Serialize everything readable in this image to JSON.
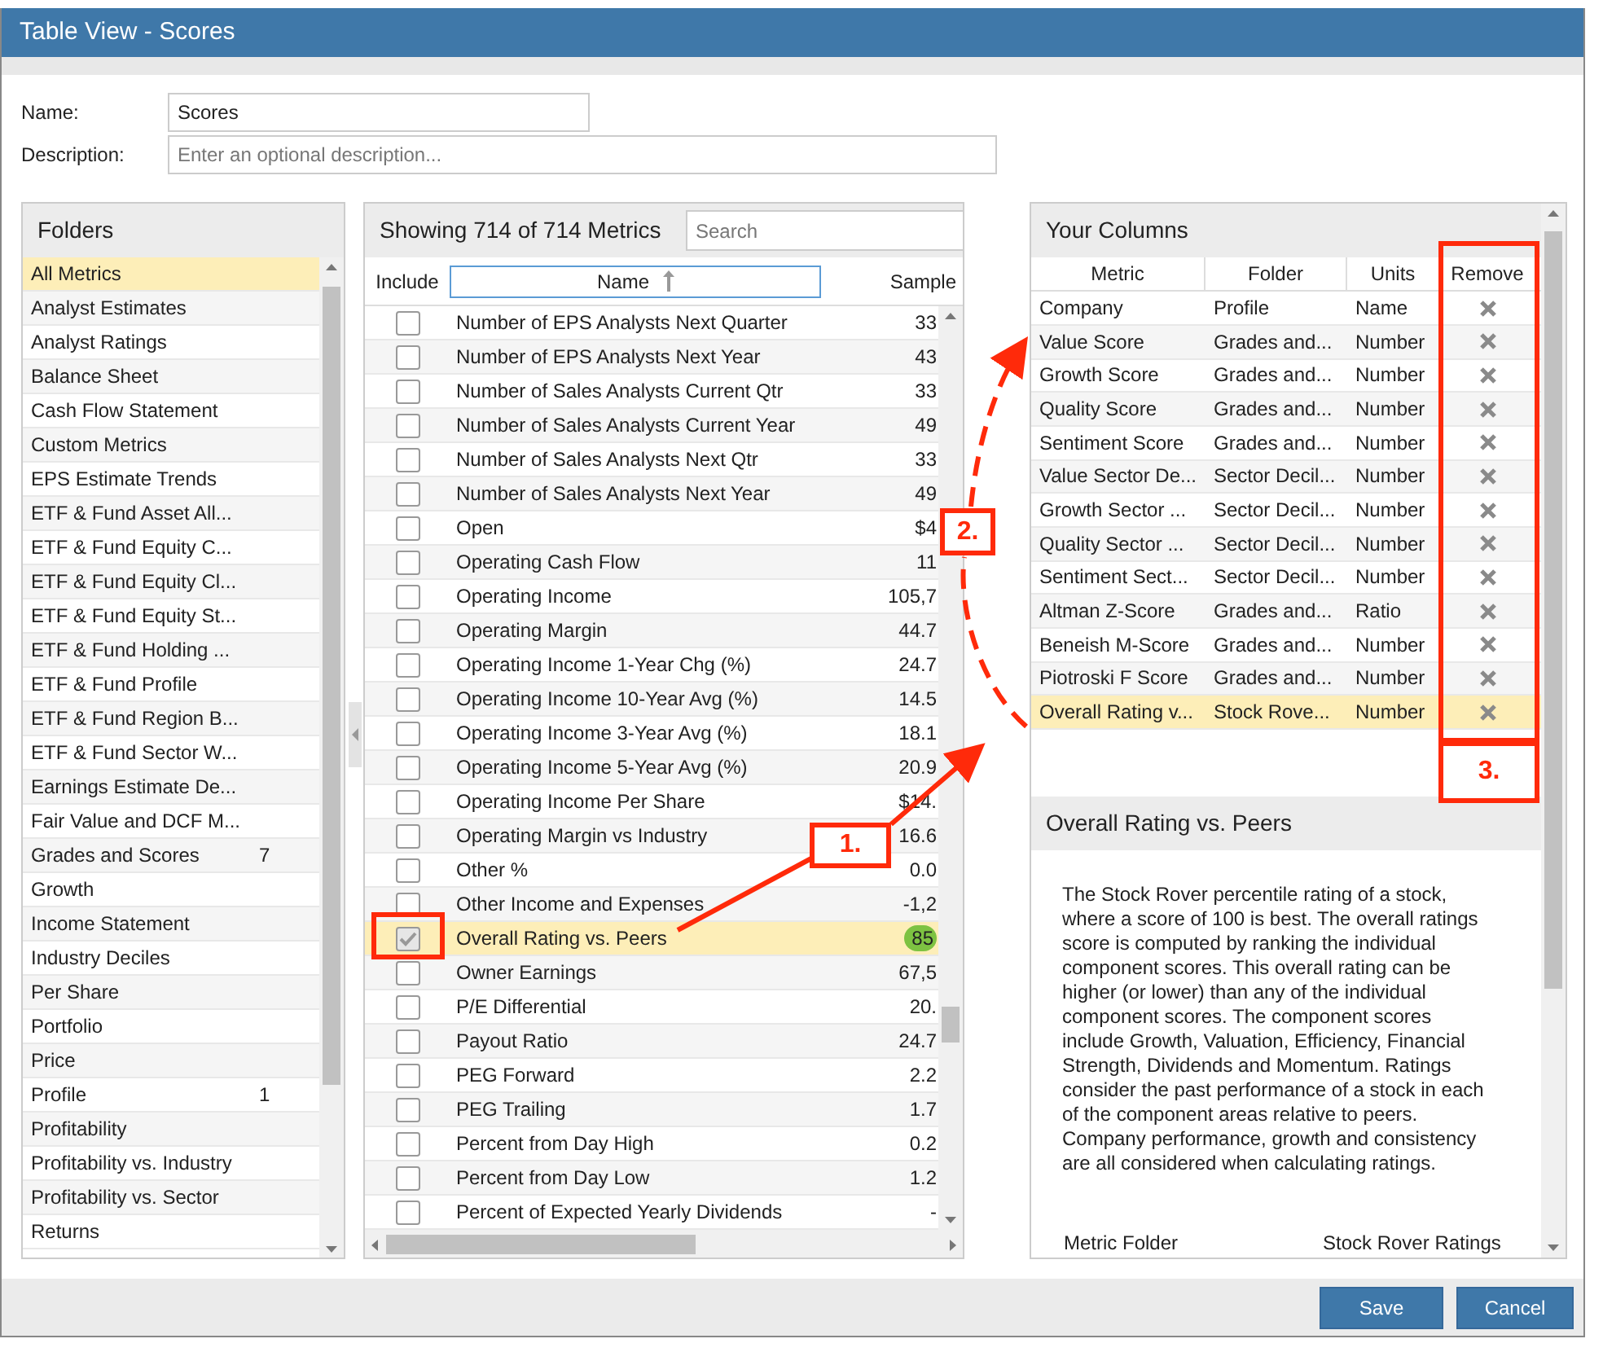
{
  "window": {
    "title": "Table View - Scores"
  },
  "form": {
    "name_label": "Name:",
    "name_value": "Scores",
    "description_label": "Description:",
    "description_placeholder": "Enter an optional description..."
  },
  "folders": {
    "title": "Folders",
    "items": [
      {
        "label": "All Metrics",
        "selected": true
      },
      {
        "label": "Analyst Estimates",
        "selected": false
      },
      {
        "label": "Analyst Ratings",
        "selected": false
      },
      {
        "label": "Balance Sheet",
        "selected": false
      },
      {
        "label": "Cash Flow Statement",
        "selected": false
      },
      {
        "label": "Custom Metrics",
        "selected": false
      },
      {
        "label": "EPS Estimate Trends",
        "selected": false
      },
      {
        "label": "ETF & Fund Asset All...",
        "selected": false
      },
      {
        "label": "ETF & Fund Equity C...",
        "selected": false
      },
      {
        "label": "ETF & Fund Equity Cl...",
        "selected": false
      },
      {
        "label": "ETF & Fund Equity St...",
        "selected": false
      },
      {
        "label": "ETF & Fund Holding ...",
        "selected": false
      },
      {
        "label": "ETF & Fund Profile",
        "selected": false
      },
      {
        "label": "ETF & Fund Region B...",
        "selected": false
      },
      {
        "label": "ETF & Fund Sector W...",
        "selected": false
      },
      {
        "label": "Earnings Estimate De...",
        "selected": false
      },
      {
        "label": "Fair Value and DCF M...",
        "selected": false
      },
      {
        "label": "Grades and Scores",
        "count": "7",
        "selected": false
      },
      {
        "label": "Growth",
        "selected": false
      },
      {
        "label": "Income Statement",
        "selected": false
      },
      {
        "label": "Industry Deciles",
        "selected": false
      },
      {
        "label": "Per Share",
        "selected": false
      },
      {
        "label": "Portfolio",
        "selected": false
      },
      {
        "label": "Price",
        "selected": false
      },
      {
        "label": "Profile",
        "count": "1",
        "selected": false
      },
      {
        "label": "Profitability",
        "selected": false
      },
      {
        "label": "Profitability vs. Industry",
        "selected": false
      },
      {
        "label": "Profitability vs. Sector",
        "selected": false
      },
      {
        "label": "Returns",
        "selected": false
      }
    ]
  },
  "metrics": {
    "title": "Showing 714 of 714 Metrics",
    "search_placeholder": "Search",
    "columns": [
      "Include",
      "Name",
      "Sample"
    ],
    "rows": [
      {
        "name": "Number of EPS Analysts Next Quarter",
        "sample": "33",
        "checked": false,
        "selected": false
      },
      {
        "name": "Number of EPS Analysts Next Year",
        "sample": "43",
        "checked": false,
        "selected": false
      },
      {
        "name": "Number of Sales Analysts Current Qtr",
        "sample": "33",
        "checked": false,
        "selected": false
      },
      {
        "name": "Number of Sales Analysts Current Year",
        "sample": "49",
        "checked": false,
        "selected": false
      },
      {
        "name": "Number of Sales Analysts Next Qtr",
        "sample": "33",
        "checked": false,
        "selected": false
      },
      {
        "name": "Number of Sales Analysts Next Year",
        "sample": "49",
        "checked": false,
        "selected": false
      },
      {
        "name": "Open",
        "sample": "$4",
        "checked": false,
        "selected": false
      },
      {
        "name": "Operating Cash Flow",
        "sample": "11",
        "checked": false,
        "selected": false
      },
      {
        "name": "Operating Income",
        "sample": "105,7",
        "checked": false,
        "selected": false
      },
      {
        "name": "Operating Margin",
        "sample": "44.7",
        "checked": false,
        "selected": false
      },
      {
        "name": "Operating Income 1-Year Chg (%)",
        "sample": "24.7",
        "checked": false,
        "selected": false
      },
      {
        "name": "Operating Income 10-Year Avg (%)",
        "sample": "14.5",
        "checked": false,
        "selected": false
      },
      {
        "name": "Operating Income 3-Year Avg (%)",
        "sample": "18.1",
        "checked": false,
        "selected": false
      },
      {
        "name": "Operating Income 5-Year Avg (%)",
        "sample": "20.9",
        "checked": false,
        "selected": false
      },
      {
        "name": "Operating Income Per Share",
        "sample": "$14.",
        "checked": false,
        "selected": false
      },
      {
        "name": "Operating Margin vs Industry",
        "sample": "16.6",
        "checked": false,
        "selected": false
      },
      {
        "name": "Other %",
        "sample": "0.0",
        "checked": false,
        "selected": false
      },
      {
        "name": "Other Income and Expenses",
        "sample": "-1,2",
        "checked": false,
        "selected": false
      },
      {
        "name": "Overall Rating vs. Peers",
        "sample": "85",
        "sample_badge": true,
        "checked": true,
        "selected": true
      },
      {
        "name": "Owner Earnings",
        "sample": "67,5",
        "checked": false,
        "selected": false
      },
      {
        "name": "P/E Differential",
        "sample": "20.",
        "checked": false,
        "selected": false
      },
      {
        "name": "Payout Ratio",
        "sample": "24.7",
        "checked": false,
        "selected": false
      },
      {
        "name": "PEG Forward",
        "sample": "2.2",
        "checked": false,
        "selected": false
      },
      {
        "name": "PEG Trailing",
        "sample": "1.7",
        "checked": false,
        "selected": false
      },
      {
        "name": "Percent from Day High",
        "sample": "0.2",
        "checked": false,
        "selected": false
      },
      {
        "name": "Percent from Day Low",
        "sample": "1.2",
        "checked": false,
        "selected": false
      },
      {
        "name": "Percent of Expected Yearly Dividends",
        "sample": "-",
        "checked": false,
        "selected": false
      }
    ]
  },
  "your_columns": {
    "title": "Your Columns",
    "columns": [
      "Metric",
      "Folder",
      "Units",
      "Remove"
    ],
    "rows": [
      {
        "metric": "Company",
        "folder": "Profile",
        "units": "Name",
        "selected": false
      },
      {
        "metric": "Value Score",
        "folder": "Grades and...",
        "units": "Number",
        "selected": false
      },
      {
        "metric": "Growth Score",
        "folder": "Grades and...",
        "units": "Number",
        "selected": false
      },
      {
        "metric": "Quality Score",
        "folder": "Grades and...",
        "units": "Number",
        "selected": false
      },
      {
        "metric": "Sentiment Score",
        "folder": "Grades and...",
        "units": "Number",
        "selected": false
      },
      {
        "metric": "Value Sector De...",
        "folder": "Sector Decil...",
        "units": "Number",
        "selected": false
      },
      {
        "metric": "Growth Sector ...",
        "folder": "Sector Decil...",
        "units": "Number",
        "selected": false
      },
      {
        "metric": "Quality Sector ...",
        "folder": "Sector Decil...",
        "units": "Number",
        "selected": false
      },
      {
        "metric": "Sentiment Sect...",
        "folder": "Sector Decil...",
        "units": "Number",
        "selected": false
      },
      {
        "metric": "Altman Z-Score",
        "folder": "Grades and...",
        "units": "Ratio",
        "selected": false
      },
      {
        "metric": "Beneish M-Score",
        "folder": "Grades and...",
        "units": "Number",
        "selected": false
      },
      {
        "metric": "Piotroski F Score",
        "folder": "Grades and...",
        "units": "Number",
        "selected": false
      },
      {
        "metric": "Overall Rating v...",
        "folder": "Stock Rove...",
        "units": "Number",
        "selected": true
      }
    ]
  },
  "detail": {
    "title": "Overall Rating vs. Peers",
    "description": "The Stock Rover percentile rating of a stock, where a score of 100 is best. The overall ratings score is computed by ranking the individual component scores. This overall rating can be higher (or lower) than any of the individual component scores. The component scores include Growth, Valuation, Efficiency, Financial Strength, Dividends and Momentum. Ratings consider the past performance of a stock in each of the component areas relative to peers. Company performance, growth and consistency are all considered when calculating ratings.",
    "properties": [
      {
        "label": "Metric Folder",
        "value": "Stock Rover Ratings"
      }
    ]
  },
  "buttons": [
    "Save",
    "Cancel"
  ],
  "annotations": [
    "1.",
    "2.",
    "3."
  ]
}
